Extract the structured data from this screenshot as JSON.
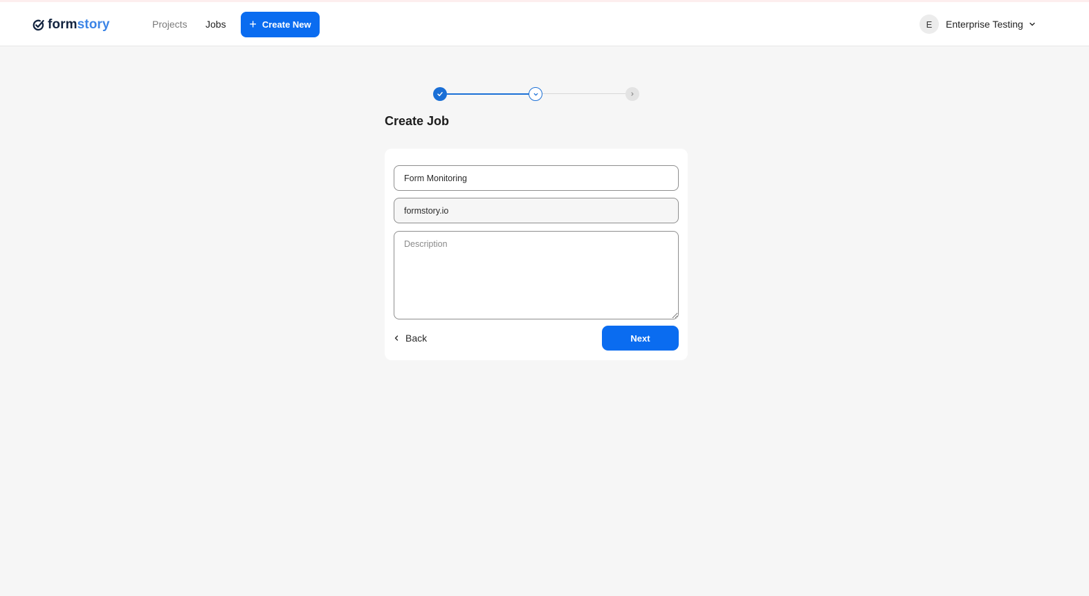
{
  "brand": {
    "name_part1": "form",
    "name_part2": "story",
    "accent_color": "#3b84e6",
    "dark_color": "#12233f"
  },
  "nav": {
    "projects_label": "Projects",
    "jobs_label": "Jobs",
    "active": "Jobs",
    "create_label": "Create New",
    "create_icon": "plus-icon"
  },
  "user": {
    "initial": "E",
    "name": "Enterprise Testing",
    "menu_icon": "chevron-down-icon"
  },
  "stepper": {
    "steps": [
      {
        "state": "completed",
        "icon": "check-icon"
      },
      {
        "state": "current",
        "icon": "chevron-down-icon"
      },
      {
        "state": "upcoming",
        "icon": "chevron-right-icon"
      }
    ]
  },
  "page": {
    "title": "Create Job"
  },
  "form": {
    "name_value": "Form Monitoring",
    "url_value": "formstory.io",
    "description_value": "",
    "description_placeholder": "Description",
    "back_label": "Back",
    "next_label": "Next"
  },
  "colors": {
    "primary": "#0a6cf0",
    "page_bg": "#f6f6f6"
  }
}
